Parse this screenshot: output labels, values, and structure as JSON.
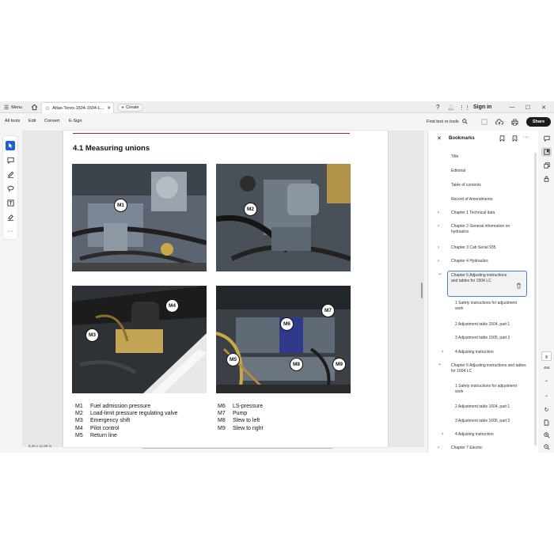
{
  "titlebar": {
    "menu_label": "Menu",
    "tab_title": "Atlas-Terex-1504-1604-L...",
    "create_label": "Create",
    "sign_in_label": "Sign in"
  },
  "toolbar": {
    "all_tools": "All tools",
    "edit": "Edit",
    "convert": "Convert",
    "esign": "E-Sign",
    "find_label": "Find text or tools",
    "share_label": "Share"
  },
  "document": {
    "section_title": "4.1 Measuring unions",
    "callouts": [
      "M1",
      "M2",
      "M4",
      "M3",
      "M7",
      "M6",
      "M5",
      "M8",
      "M9"
    ],
    "legend_left": [
      {
        "code": "M1",
        "text": "Fuel admission pressure"
      },
      {
        "code": "M2",
        "text": "Load-limit pressure regulating valve"
      },
      {
        "code": "M3",
        "text": "Emergency shift"
      },
      {
        "code": "M4",
        "text": "Pilot control"
      },
      {
        "code": "M5",
        "text": "Return line"
      }
    ],
    "legend_right": [
      {
        "code": "M6",
        "text": "LS-pressure"
      },
      {
        "code": "M7",
        "text": "Pump"
      },
      {
        "code": "M8",
        "text": "Slew to left"
      },
      {
        "code": "M9",
        "text": "Slew to right"
      }
    ],
    "page_size": "8,26 x 11,69 in"
  },
  "bookmarks": {
    "title": "Bookmarks",
    "items": [
      {
        "label": "Title",
        "chevron": ""
      },
      {
        "label": "Editorial",
        "chevron": ""
      },
      {
        "label": "Table of contents",
        "chevron": ""
      },
      {
        "label": "Record of Amendments",
        "chevron": ""
      },
      {
        "label": "Chapter 1 Technical data",
        "chevron": "›"
      },
      {
        "label": "Chapter 2 General information on hydraulics",
        "chevron": "›"
      },
      {
        "label": "Chapter 3 Cab Serial 935",
        "chevron": "›"
      },
      {
        "label": "Chapter 4 Hydraulics",
        "chevron": "›"
      },
      {
        "label": "Chapter 5 Adjusting instructions and tables for 1504 LC",
        "chevron": "⌄"
      },
      {
        "label": "1 Safety instructions for adjustment work",
        "chevron": ""
      },
      {
        "label": "2 Adjustment table 1504, part 1",
        "chevron": ""
      },
      {
        "label": "3 Adjustment table 1505, part 2",
        "chevron": ""
      },
      {
        "label": "4 Adjusting instruction",
        "chevron": "›"
      },
      {
        "label": "Chapter 6 Adjusting instructions and tables for 1604 LC",
        "chevron": "⌄"
      },
      {
        "label": "1 Safety instructions for adjustment work",
        "chevron": ""
      },
      {
        "label": "2 Adjustment table 1604, part 1",
        "chevron": ""
      },
      {
        "label": "3 Adjustment table 1605, part 2",
        "chevron": ""
      },
      {
        "label": "4 Adjusting instruction",
        "chevron": "›"
      },
      {
        "label": "Chapter 7 Electric",
        "chevron": "›"
      }
    ]
  },
  "right_rail": {
    "page_number": "456"
  },
  "colors": {
    "accent": "#1b5fd1",
    "selected_border": "#4a7fd4",
    "rule": "#a0282a"
  }
}
